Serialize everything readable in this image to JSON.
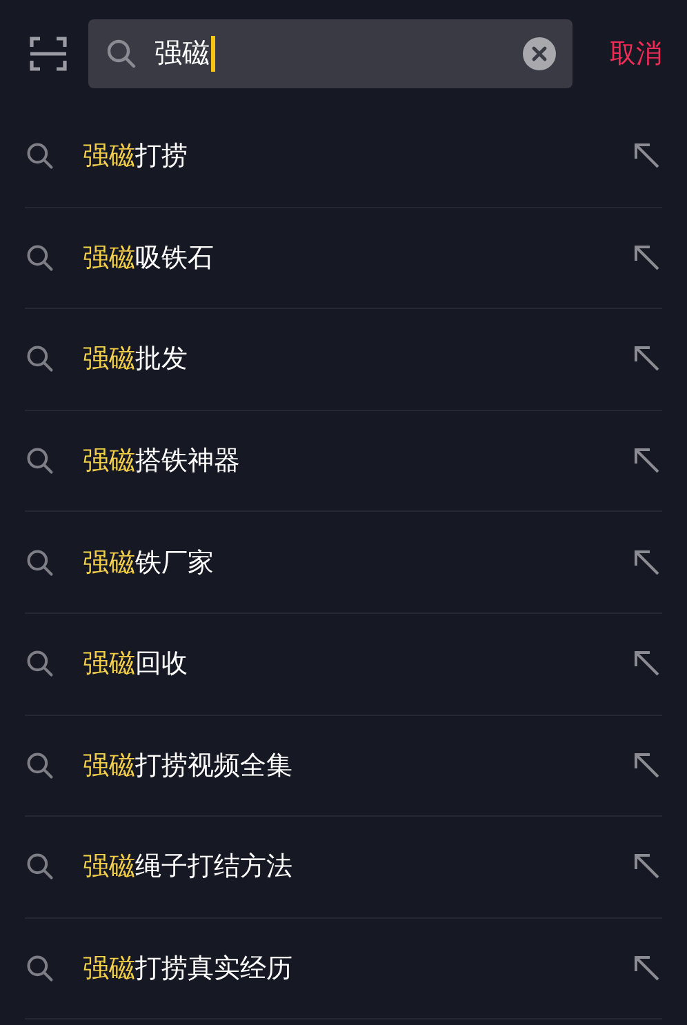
{
  "search": {
    "value": "强磁",
    "cancel": "取消"
  },
  "suggestions": [
    {
      "match": "强磁",
      "rest": "打捞"
    },
    {
      "match": "强磁",
      "rest": "吸铁石"
    },
    {
      "match": "强磁",
      "rest": "批发"
    },
    {
      "match": "强磁",
      "rest": "搭铁神器"
    },
    {
      "match": "强磁",
      "rest": "铁厂家"
    },
    {
      "match": "强磁",
      "rest": "回收"
    },
    {
      "match": "强磁",
      "rest": "打捞视频全集"
    },
    {
      "match": "强磁",
      "rest": "绳子打结方法"
    },
    {
      "match": "强磁",
      "rest": "打捞真实经历"
    }
  ]
}
